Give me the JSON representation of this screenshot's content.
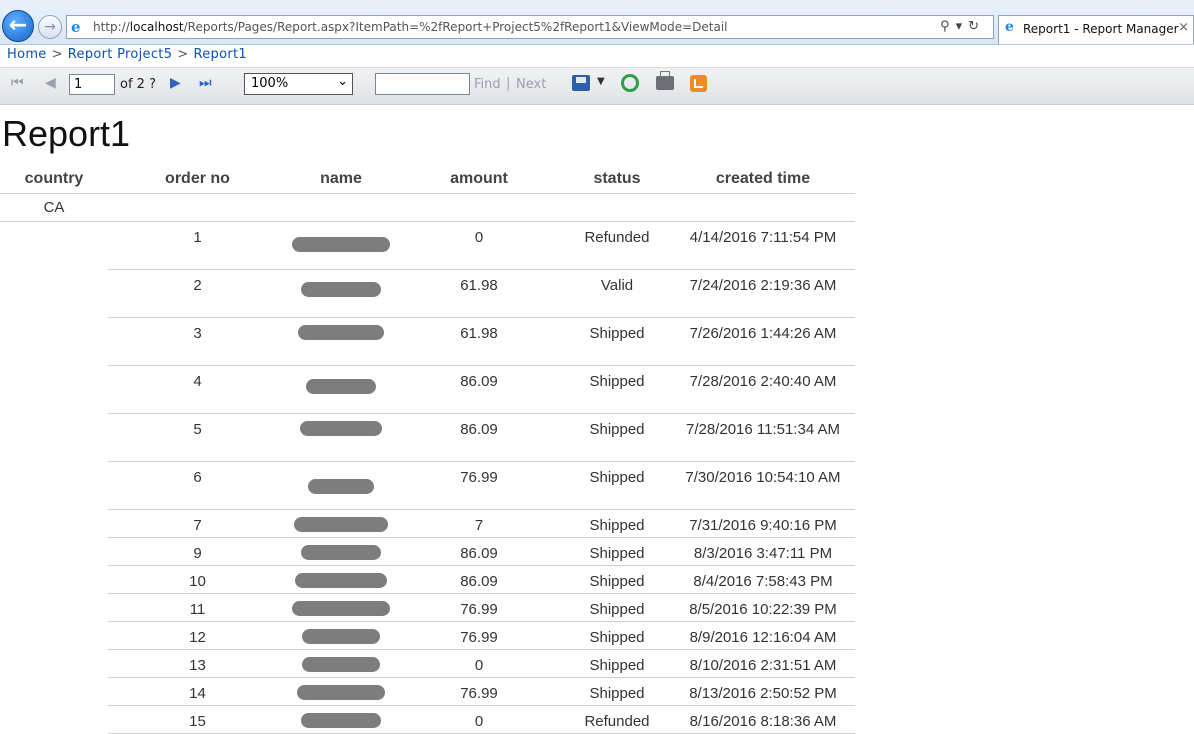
{
  "browser": {
    "url_prefix": "http://",
    "url_host": "localhost",
    "url_path": "/Reports/Pages/Report.aspx?ItemPath=%2fReport+Project5%2fReport1&ViewMode=Detail",
    "tab_title": "Report1 - Report Manager",
    "tab_close": "×"
  },
  "breadcrumb": {
    "items": [
      "Home",
      "Report Project5",
      "Report1"
    ],
    "separator": ">"
  },
  "toolbar": {
    "page_value": "1",
    "of_pages": "of 2 ?",
    "zoom": "100%",
    "find": "Find",
    "find_sep": "|",
    "next": "Next"
  },
  "report": {
    "title": "Report1",
    "columns": [
      "country",
      "order no",
      "name",
      "amount",
      "status",
      "created time"
    ],
    "group": "CA",
    "rows": [
      {
        "order_no": "1",
        "amount": "0",
        "status": "Refunded",
        "created": "4/14/2016 7:11:54 PM"
      },
      {
        "order_no": "2",
        "amount": "61.98",
        "status": "Valid",
        "created": "7/24/2016 2:19:36 AM"
      },
      {
        "order_no": "3",
        "amount": "61.98",
        "status": "Shipped",
        "created": "7/26/2016 1:44:26 AM"
      },
      {
        "order_no": "4",
        "amount": "86.09",
        "status": "Shipped",
        "created": "7/28/2016 2:40:40 AM"
      },
      {
        "order_no": "5",
        "amount": "86.09",
        "status": "Shipped",
        "created": "7/28/2016 11:51:34 AM"
      },
      {
        "order_no": "6",
        "amount": "76.99",
        "status": "Shipped",
        "created": "7/30/2016 10:54:10 AM"
      },
      {
        "order_no": "7",
        "amount": "7",
        "status": "Shipped",
        "created": "7/31/2016 9:40:16 PM"
      },
      {
        "order_no": "9",
        "amount": "86.09",
        "status": "Shipped",
        "created": "8/3/2016 3:47:11 PM"
      },
      {
        "order_no": "10",
        "amount": "86.09",
        "status": "Shipped",
        "created": "8/4/2016 7:58:43 PM"
      },
      {
        "order_no": "11",
        "amount": "76.99",
        "status": "Shipped",
        "created": "8/5/2016 10:22:39 PM"
      },
      {
        "order_no": "12",
        "amount": "76.99",
        "status": "Shipped",
        "created": "8/9/2016 12:16:04 AM"
      },
      {
        "order_no": "13",
        "amount": "0",
        "status": "Shipped",
        "created": "8/10/2016 2:31:51 AM"
      },
      {
        "order_no": "14",
        "amount": "76.99",
        "status": "Shipped",
        "created": "8/13/2016 2:50:52 PM"
      },
      {
        "order_no": "15",
        "amount": "0",
        "status": "Refunded",
        "created": "8/16/2016 8:18:36 AM"
      }
    ]
  }
}
